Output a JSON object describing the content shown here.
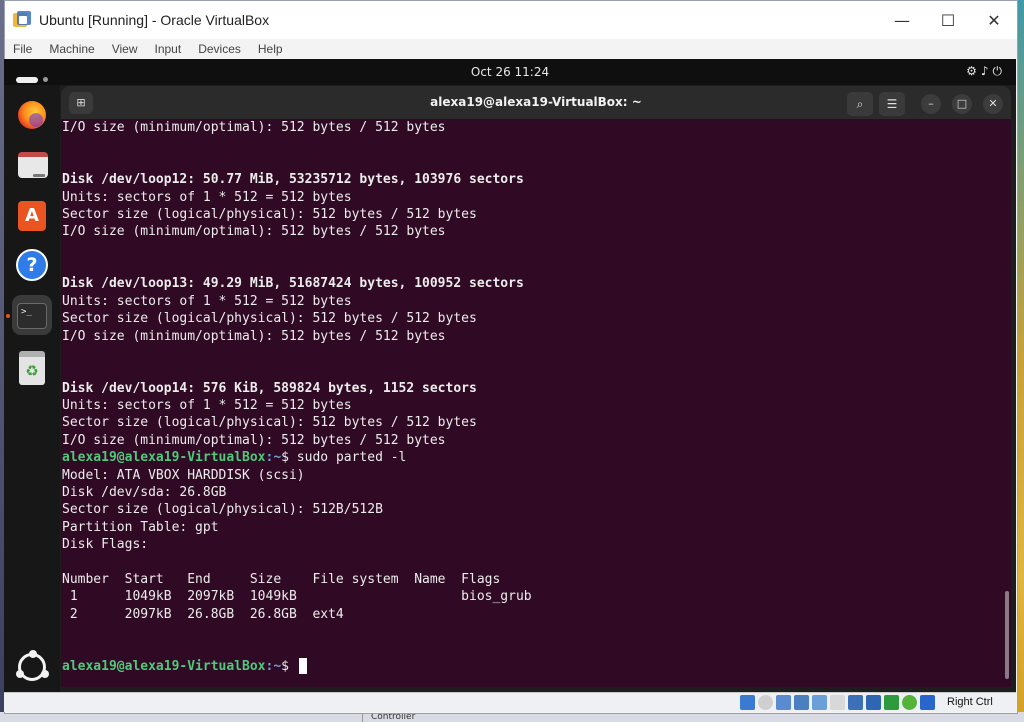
{
  "vbox": {
    "title": "Ubuntu [Running] - Oracle VirtualBox",
    "menu": [
      "File",
      "Machine",
      "View",
      "Input",
      "Devices",
      "Help"
    ],
    "controls": {
      "minimize": "—",
      "maximize": "☐",
      "close": "✕"
    },
    "status_host_key": "Right Ctrl"
  },
  "host_taskbar": {
    "label": "Controller"
  },
  "gnome": {
    "clock": "Oct 26  11:24",
    "tray": "⚙♪⏻"
  },
  "dock": [
    {
      "name": "firefox"
    },
    {
      "name": "files"
    },
    {
      "name": "app-center"
    },
    {
      "name": "help"
    },
    {
      "name": "terminal"
    },
    {
      "name": "trash"
    }
  ],
  "terminal": {
    "title": "alexa19@alexa19-VirtualBox: ~",
    "prompt_user": "alexa19@alexa19-VirtualBox",
    "prompt_path": ":~",
    "prompt_symbol": "$",
    "lines": [
      {
        "text": "I/O size (minimum/optimal): 512 bytes / 512 bytes",
        "bold": false
      },
      {
        "text": "",
        "bold": false
      },
      {
        "text": "",
        "bold": false
      },
      {
        "text": "Disk /dev/loop12: 50.77 MiB, 53235712 bytes, 103976 sectors",
        "bold": true
      },
      {
        "text": "Units: sectors of 1 * 512 = 512 bytes",
        "bold": false
      },
      {
        "text": "Sector size (logical/physical): 512 bytes / 512 bytes",
        "bold": false
      },
      {
        "text": "I/O size (minimum/optimal): 512 bytes / 512 bytes",
        "bold": false
      },
      {
        "text": "",
        "bold": false
      },
      {
        "text": "",
        "bold": false
      },
      {
        "text": "Disk /dev/loop13: 49.29 MiB, 51687424 bytes, 100952 sectors",
        "bold": true
      },
      {
        "text": "Units: sectors of 1 * 512 = 512 bytes",
        "bold": false
      },
      {
        "text": "Sector size (logical/physical): 512 bytes / 512 bytes",
        "bold": false
      },
      {
        "text": "I/O size (minimum/optimal): 512 bytes / 512 bytes",
        "bold": false
      },
      {
        "text": "",
        "bold": false
      },
      {
        "text": "",
        "bold": false
      },
      {
        "text": "Disk /dev/loop14: 576 KiB, 589824 bytes, 1152 sectors",
        "bold": true
      },
      {
        "text": "Units: sectors of 1 * 512 = 512 bytes",
        "bold": false
      },
      {
        "text": "Sector size (logical/physical): 512 bytes / 512 bytes",
        "bold": false
      },
      {
        "text": "I/O size (minimum/optimal): 512 bytes / 512 bytes",
        "bold": false
      },
      {
        "prompt": true,
        "command": " sudo parted -l"
      },
      {
        "text": "Model: ATA VBOX HARDDISK (scsi)",
        "bold": false
      },
      {
        "text": "Disk /dev/sda: 26.8GB",
        "bold": false
      },
      {
        "text": "Sector size (logical/physical): 512B/512B",
        "bold": false
      },
      {
        "text": "Partition Table: gpt",
        "bold": false
      },
      {
        "text": "Disk Flags:",
        "bold": false
      },
      {
        "text": "",
        "bold": false
      },
      {
        "text": "Number  Start   End     Size    File system  Name  Flags",
        "bold": false
      },
      {
        "text": " 1      1049kB  2097kB  1049kB                     bios_grub",
        "bold": false
      },
      {
        "text": " 2      2097kB  26.8GB  26.8GB  ext4",
        "bold": false
      },
      {
        "text": "",
        "bold": false
      },
      {
        "text": "",
        "bold": false
      },
      {
        "prompt": true,
        "command": " ",
        "cursor": true
      }
    ]
  }
}
